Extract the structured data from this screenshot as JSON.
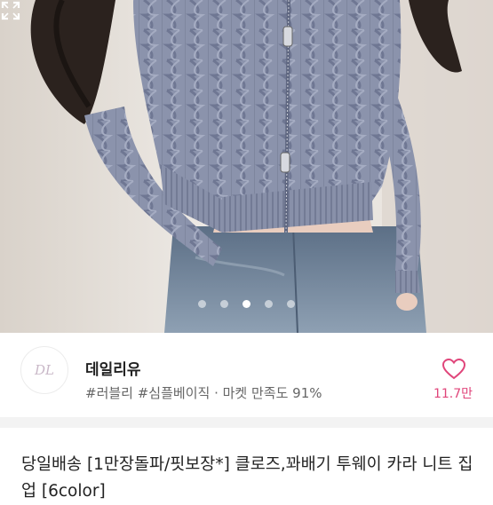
{
  "product_image": {
    "alt": "",
    "dot_count": 5,
    "active_index": 2
  },
  "shop": {
    "logo_text": "DL",
    "name": "데일리유",
    "tags": "#러블리 #심플베이직 · 마켓 만족도 91%",
    "like_count": "11.7만"
  },
  "product": {
    "title": "당일배송 [1만장돌파/핏보장*] 클로즈,꽈배기 투웨이 카라 니트 집업 [6color]"
  },
  "colors": {
    "accent": "#e0457a",
    "cardigan": "#8c94ad",
    "denim": "#6f8298"
  },
  "icons": {
    "expand": "expand-icon",
    "like": "heart-icon"
  }
}
